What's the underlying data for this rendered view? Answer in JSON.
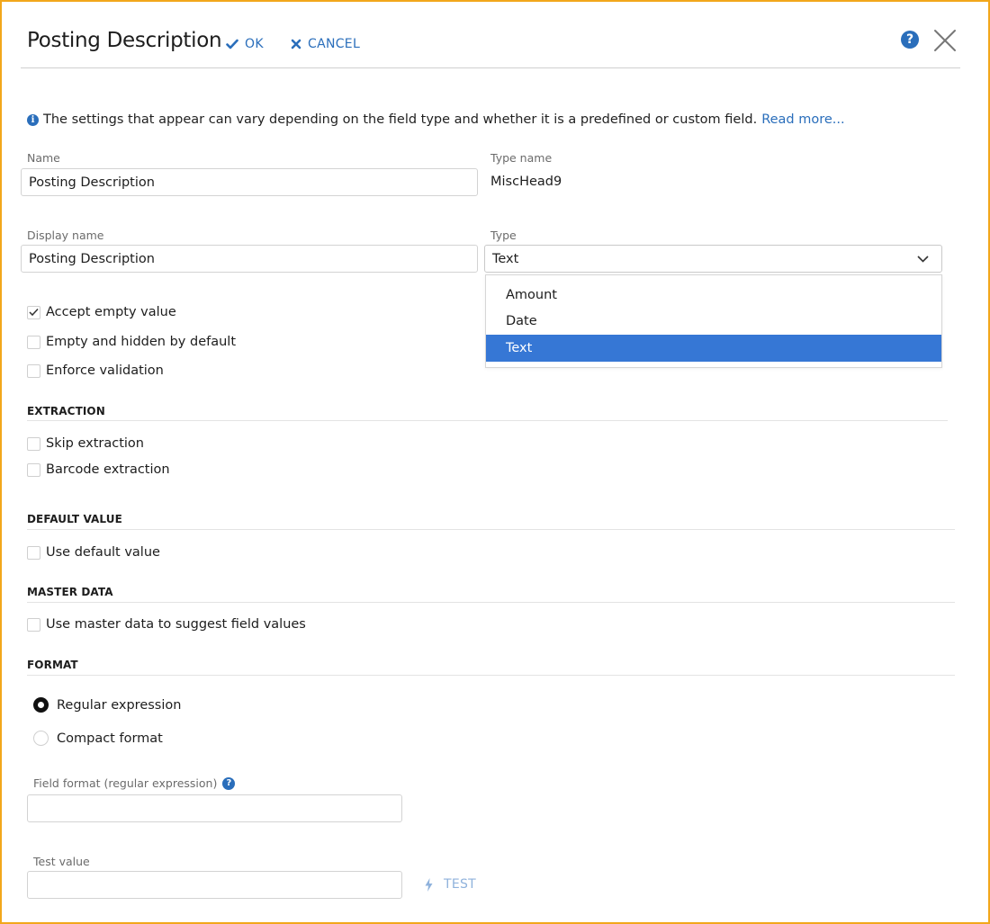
{
  "header": {
    "title": "Posting Description",
    "ok_label": "OK",
    "cancel_label": "CANCEL"
  },
  "info": {
    "text": "The settings that appear can vary depending on the field type and whether it is a predefined or custom field.",
    "link": "Read more..."
  },
  "fields": {
    "name_label": "Name",
    "name_value": "Posting Description",
    "type_name_label": "Type name",
    "type_name_value": "MiscHead9",
    "display_name_label": "Display name",
    "display_name_value": "Posting Description",
    "type_label": "Type",
    "type_value": "Text",
    "type_options": [
      "Amount",
      "Date",
      "Text"
    ]
  },
  "checkboxes": {
    "accept_empty": "Accept empty value",
    "empty_hidden": "Empty and hidden by default",
    "enforce_validation": "Enforce validation"
  },
  "extraction": {
    "title": "EXTRACTION",
    "skip": "Skip extraction",
    "barcode": "Barcode extraction"
  },
  "default_value": {
    "title": "DEFAULT VALUE",
    "use_default": "Use default value"
  },
  "master_data": {
    "title": "MASTER DATA",
    "use_master": "Use master data to suggest field values"
  },
  "format": {
    "title": "FORMAT",
    "regex_label": "Regular expression",
    "compact_label": "Compact format",
    "field_format_label": "Field format (regular expression)",
    "field_format_value": "",
    "test_value_label": "Test value",
    "test_value": "",
    "test_button": "TEST"
  },
  "state": {
    "accept_empty_checked": true,
    "selected_format": "Regular expression",
    "selected_type_option": "Text"
  },
  "colors": {
    "accent": "#2a6ebb",
    "selected_option_bg": "#3677d5",
    "frame_border": "#f2a71b"
  }
}
